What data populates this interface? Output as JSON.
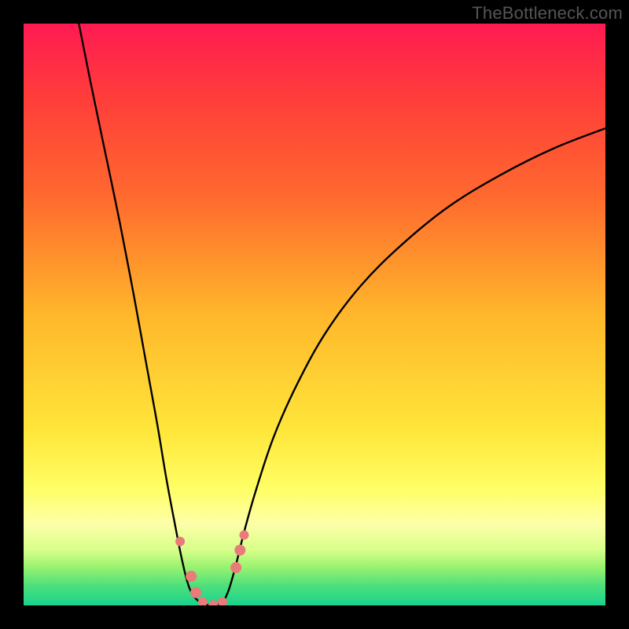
{
  "watermark": "TheBottleneck.com",
  "chart_data": {
    "type": "line",
    "title": "",
    "xlabel": "",
    "ylabel": "",
    "xlim": [
      0,
      100
    ],
    "ylim": [
      0,
      100
    ],
    "gradient_stops": [
      {
        "offset": 0.0,
        "color": "#ff1a53"
      },
      {
        "offset": 0.12,
        "color": "#ff3b3b"
      },
      {
        "offset": 0.3,
        "color": "#ff6a2e"
      },
      {
        "offset": 0.5,
        "color": "#ffb72b"
      },
      {
        "offset": 0.7,
        "color": "#ffe63a"
      },
      {
        "offset": 0.8,
        "color": "#ffff66"
      },
      {
        "offset": 0.86,
        "color": "#fdffa8"
      },
      {
        "offset": 0.905,
        "color": "#d7ff8a"
      },
      {
        "offset": 0.935,
        "color": "#97f26f"
      },
      {
        "offset": 0.965,
        "color": "#4fe07b"
      },
      {
        "offset": 1.0,
        "color": "#19d38e"
      }
    ],
    "series": [
      {
        "name": "bottleneck-curve",
        "points": [
          {
            "x": 9.5,
            "y": 100.0
          },
          {
            "x": 11.5,
            "y": 90.0
          },
          {
            "x": 14.0,
            "y": 78.0
          },
          {
            "x": 16.5,
            "y": 66.0
          },
          {
            "x": 19.0,
            "y": 53.0
          },
          {
            "x": 21.0,
            "y": 42.0
          },
          {
            "x": 23.0,
            "y": 31.0
          },
          {
            "x": 24.5,
            "y": 22.0
          },
          {
            "x": 26.0,
            "y": 14.0
          },
          {
            "x": 27.3,
            "y": 7.5
          },
          {
            "x": 28.5,
            "y": 3.0
          },
          {
            "x": 30.0,
            "y": 0.8
          },
          {
            "x": 32.0,
            "y": 0.0
          },
          {
            "x": 34.0,
            "y": 0.5
          },
          {
            "x": 35.2,
            "y": 2.5
          },
          {
            "x": 36.5,
            "y": 7.0
          },
          {
            "x": 38.0,
            "y": 13.0
          },
          {
            "x": 40.0,
            "y": 20.0
          },
          {
            "x": 43.0,
            "y": 29.0
          },
          {
            "x": 47.0,
            "y": 38.0
          },
          {
            "x": 52.0,
            "y": 47.0
          },
          {
            "x": 58.0,
            "y": 55.0
          },
          {
            "x": 65.0,
            "y": 62.0
          },
          {
            "x": 73.0,
            "y": 68.5
          },
          {
            "x": 82.0,
            "y": 74.0
          },
          {
            "x": 91.0,
            "y": 78.5
          },
          {
            "x": 100.0,
            "y": 82.0
          }
        ]
      }
    ],
    "markers": [
      {
        "x": 26.9,
        "y": 11.0,
        "r": 6
      },
      {
        "x": 28.8,
        "y": 5.0,
        "r": 7
      },
      {
        "x": 29.6,
        "y": 2.2,
        "r": 7
      },
      {
        "x": 30.8,
        "y": 0.6,
        "r": 6
      },
      {
        "x": 32.6,
        "y": 0.1,
        "r": 6
      },
      {
        "x": 34.2,
        "y": 0.6,
        "r": 6
      },
      {
        "x": 36.5,
        "y": 6.5,
        "r": 7
      },
      {
        "x": 37.2,
        "y": 9.5,
        "r": 7
      },
      {
        "x": 37.9,
        "y": 12.1,
        "r": 6
      }
    ],
    "marker_color": "#eb7a7a"
  }
}
